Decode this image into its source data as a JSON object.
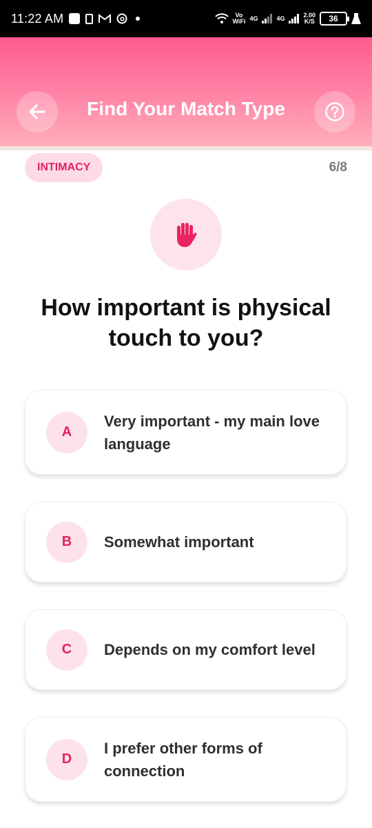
{
  "status_bar": {
    "time": "11:22 AM",
    "icons": [
      "app-square-icon",
      "sim-card-icon",
      "gmail-icon",
      "threads-icon",
      "dot-icon"
    ],
    "vowifi_top": "Vo",
    "vowifi_bottom": "WiFi",
    "network1": "4G",
    "network2": "4G",
    "speed_top": "2.00",
    "speed_bottom": "K/S",
    "battery": "36"
  },
  "header": {
    "title": "Find Your Match Type",
    "back_icon": "arrow-left-icon",
    "help_icon": "help-circle-icon",
    "gradient": [
      "#ff5b8f",
      "#ffb0b9"
    ]
  },
  "quiz": {
    "category": "INTIMACY",
    "progress": "6/8",
    "current": 6,
    "total": 8,
    "hero_icon": "hand-icon",
    "question": "How important is physical touch to you?",
    "accent": "#e0245e",
    "options": [
      {
        "letter": "A",
        "text": "Very important - my main love language"
      },
      {
        "letter": "B",
        "text": "Somewhat important"
      },
      {
        "letter": "C",
        "text": "Depends on my comfort level"
      },
      {
        "letter": "D",
        "text": "I prefer other forms of connection"
      }
    ]
  }
}
